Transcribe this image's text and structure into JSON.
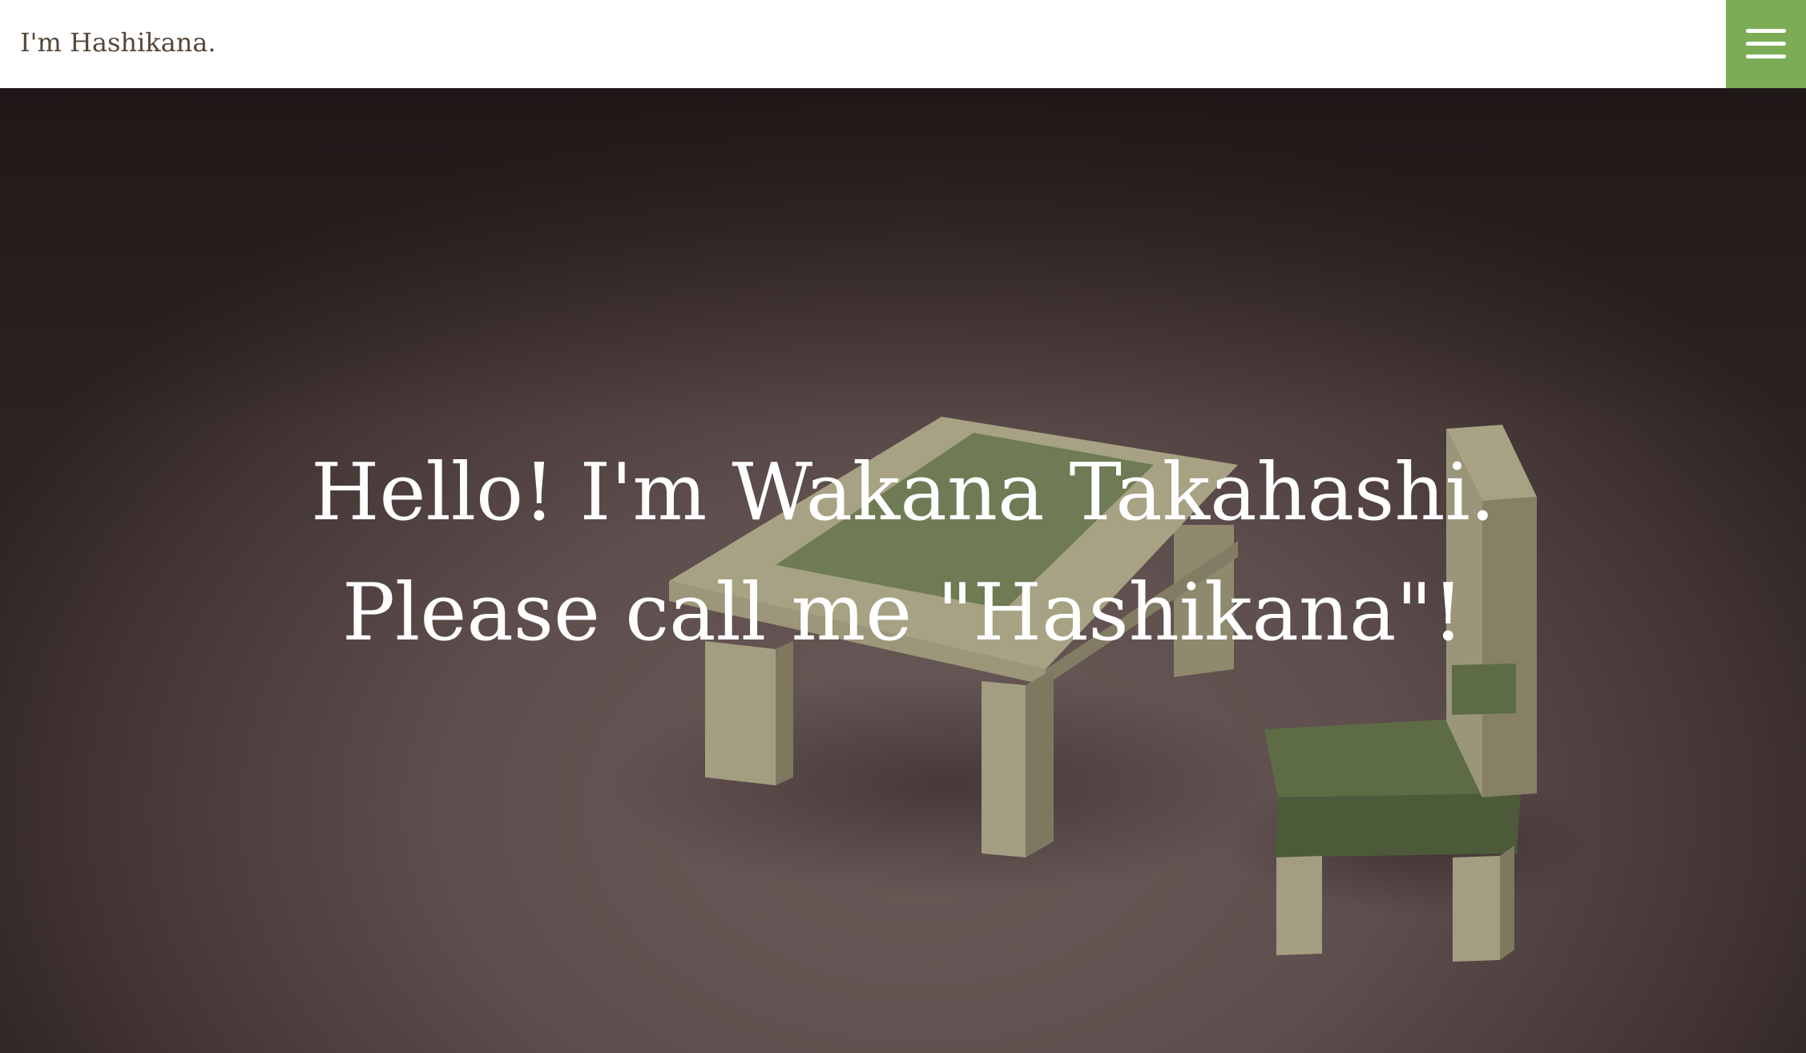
{
  "header": {
    "site_title": "I'm Hashikana.",
    "menu_icon": "hamburger-menu-icon",
    "accent_color": "#7cad56",
    "title_color": "#54473a"
  },
  "hero": {
    "heading_line1": "Hello! I'm Wakana Takahashi.",
    "heading_line2": "Please call me \"Hashikana\"!",
    "background_image": "3d-table-and-chair-illustration"
  }
}
